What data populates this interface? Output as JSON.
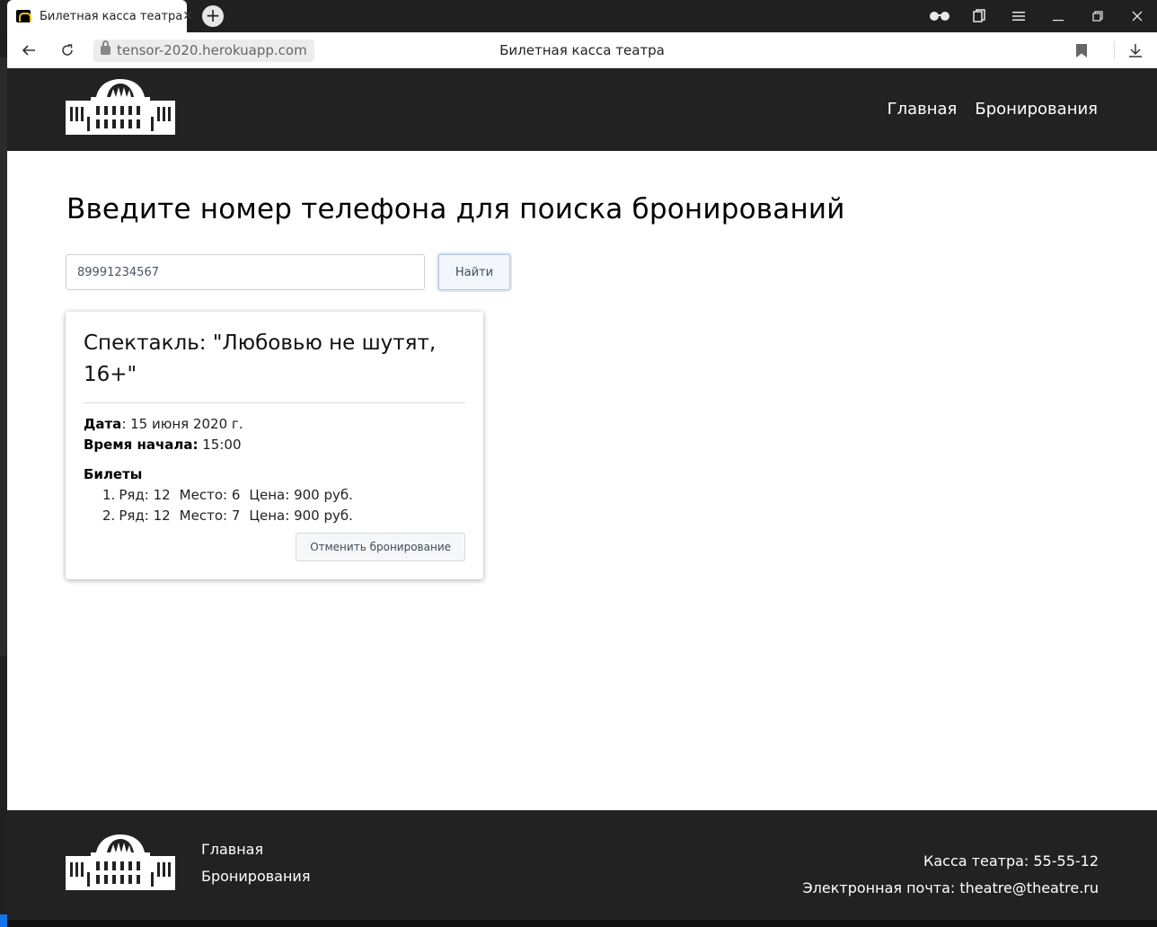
{
  "browser": {
    "tab_title": "Билетная касса театра",
    "url": "tensor-2020.herokuapp.com",
    "page_title": "Билетная касса театра"
  },
  "nav": {
    "home": "Главная",
    "bookings": "Бронирования"
  },
  "search": {
    "title": "Введите номер телефона для поиска бронирований",
    "phone_value": "89991234567",
    "button": "Найти"
  },
  "booking": {
    "title": "Спектакль: \"Любовью не шутят, 16+\"",
    "date_label": "Дата",
    "date_value": "15 июня 2020 г.",
    "time_label": "Время начала:",
    "time_value": "15:00",
    "tickets_label": "Билеты",
    "tickets": [
      {
        "num": "1.",
        "row": "Ряд: 12",
        "seat": "Место: 6",
        "price": "Цена: 900 руб."
      },
      {
        "num": "2.",
        "row": "Ряд: 12",
        "seat": "Место: 7",
        "price": "Цена: 900 руб."
      }
    ],
    "cancel_button": "Отменить бронирование"
  },
  "footer": {
    "nav_home": "Главная",
    "nav_bookings": "Бронирования",
    "phone_text": "Касса театра: 55-55-12",
    "email_text": "Электронная почта: theatre@theatre.ru"
  },
  "colors": {
    "header_bg": "#222222",
    "accent_border": "#b9c8dc"
  }
}
